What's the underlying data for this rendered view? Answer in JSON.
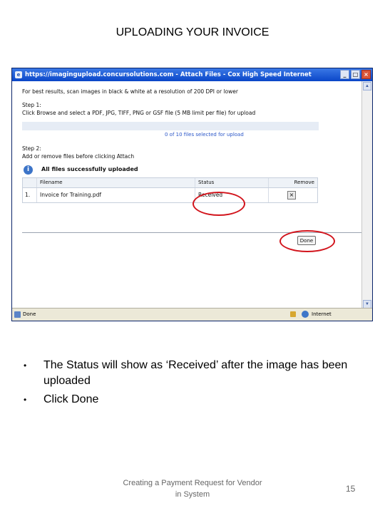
{
  "slide": {
    "title": "UPLOADING YOUR INVOICE",
    "bullets": [
      "The Status will show as ‘Received’ after the image  has been uploaded",
      "Click Done"
    ],
    "footer": "Creating a Payment Request for Vendor in System",
    "page_number": "15"
  },
  "window": {
    "title": "https://imagingupload.concursolutions.com - Attach Files - Cox High Speed Internet",
    "intro": "For best results, scan images in black & white at a resolution of 200 DPI or lower",
    "step1_label": "Step 1:",
    "step1_text": "Click Browse and select a PDF, JPG, TIFF, PNG or GSF file (5 MB limit per file) for upload",
    "files_selected": "0 of 10 files selected for upload",
    "step2_label": "Step 2:",
    "step2_text": "Add or remove files before clicking Attach",
    "success_message": "All files successfully uploaded",
    "table": {
      "headers": [
        "",
        "Filename",
        "Status",
        "Remove"
      ],
      "rows": [
        {
          "index": "1.",
          "filename": "Invoice for Training.pdf",
          "status": "Received"
        }
      ]
    },
    "done_label": "Done",
    "status_text": "Done",
    "zone_text": "Internet"
  },
  "annotations": {
    "circle_color": "#d2141c"
  }
}
